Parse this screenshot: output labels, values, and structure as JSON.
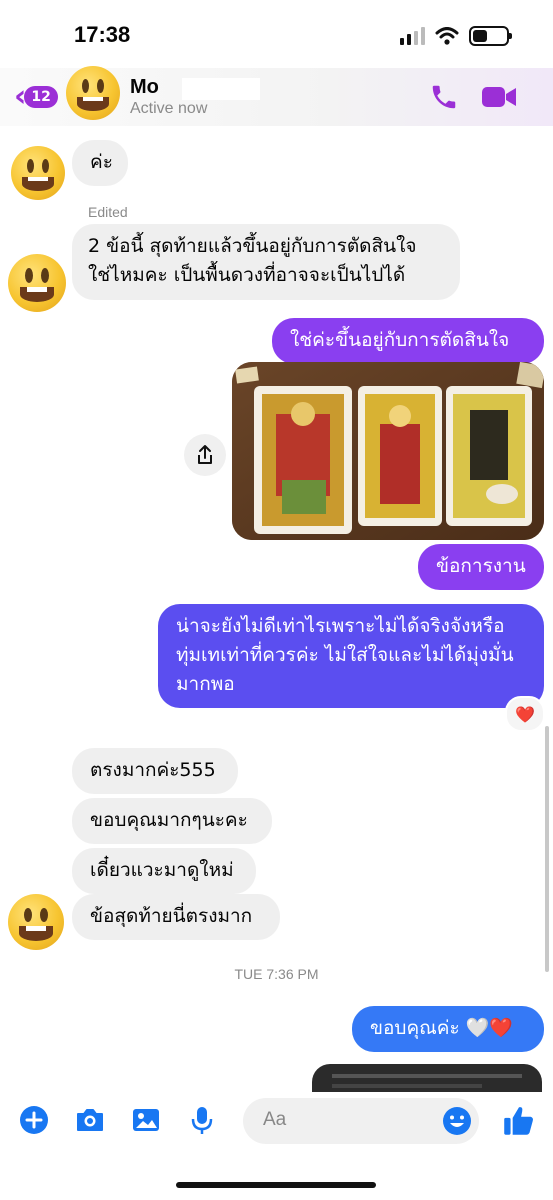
{
  "status_bar": {
    "time": "17:38",
    "battery_fraction": 0.45
  },
  "header": {
    "back_count": "12",
    "contact_name": "Mo",
    "contact_status": "Active now",
    "accent_color": "#9b2fd6"
  },
  "messages": {
    "incoming_ka": "ค่ะ",
    "edited_label": "Edited",
    "incoming_question_line1": "2 ข้อนี้ สุดท้ายแล้วขึ้นอยู่กับการตัดสินใจ",
    "incoming_question_line2": "ใช่ไหมคะ เป็นพื้นดวงที่อาจจะเป็นไปได้",
    "outgoing_decision": "ใช่ค่ะขึ้นอยู่กับการตัดสินใจ",
    "outgoing_work": "ข้อการงาน",
    "outgoing_long": "น่าจะยังไม่ดีเท่าไรเพราะไม่ได้จริงจังหรือทุ่มเทเท่าที่ควรค่ะ ไม่ใส่ใจและไม่ได้มุ่งมั่นมากพอ",
    "incoming_1": "ตรงมากค่ะ555",
    "incoming_2": "ขอบคุณมากๆนะคะ",
    "incoming_3": "เดี๋ยวแวะมาดูใหม่",
    "incoming_4": "ข้อสุดท้ายนี่ตรงมาก",
    "timestamp": "TUE 7:36 PM",
    "outgoing_thanks": "ขอบคุณค่ะ 🤍❤️",
    "reaction": "❤️"
  },
  "composer": {
    "placeholder": "Aa"
  },
  "colors": {
    "incoming_bubble": "#efefef",
    "outgoing_purple": "#8a3ff0",
    "outgoing_indigo": "#5b4ef0",
    "outgoing_blue": "#3579f6",
    "composer_icons": "#1877f2"
  }
}
